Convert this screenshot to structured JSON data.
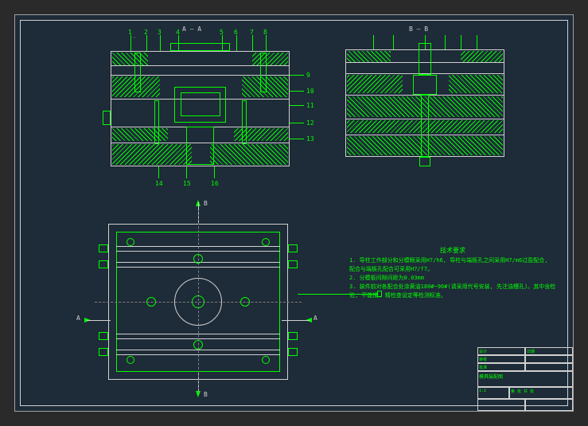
{
  "sections": {
    "aa": "A — A",
    "bb": "B — B",
    "a_mark": "A",
    "b_mark": "B"
  },
  "notes": {
    "title": "技术要求",
    "line1": "1. 导柱工作部分和分模眼采用H7/h6, 导柱与端板孔之间采用H7/m6过盈配合, 配合与端板孔配合可采用H7/f7。",
    "line2": "2. 分模板间隙间距为0.03mm",
    "line3": "3. 装件前对各配合处涂黄油180#~90#(请采用代号安装, 先注油槽孔)。其中含检验, 不能撞, 精检查设定等检测标准。"
  },
  "leaders": {
    "l1": "1",
    "l2": "2",
    "l3": "3",
    "l4": "4",
    "l5": "5",
    "l6": "6",
    "l7": "7",
    "l8": "8",
    "l9": "9",
    "l10": "10",
    "l11": "11",
    "l12": "12",
    "l13": "13",
    "l14": "14",
    "l15": "15",
    "l16": "16"
  },
  "titleblock": {
    "drawing_name": "模具装配图",
    "scale": "1:2",
    "material": "",
    "drawn": "设计",
    "checked": "审核",
    "approved": "批准",
    "date": "日期",
    "sheet": "第 张 共 张",
    "company": "",
    "number": ""
  }
}
